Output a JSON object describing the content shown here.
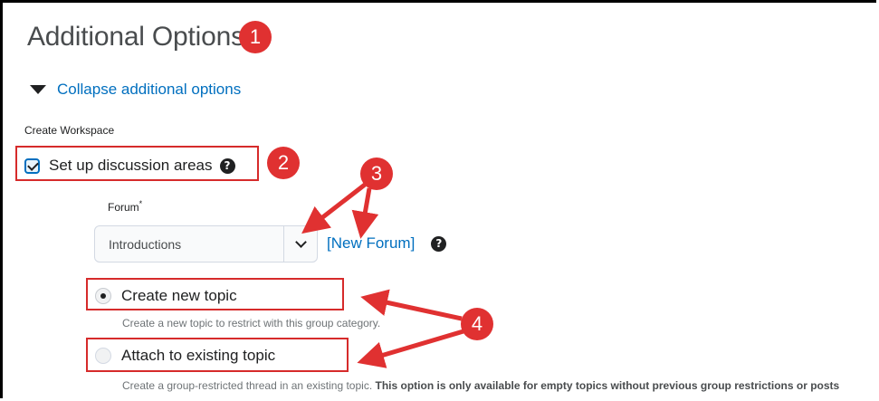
{
  "page": {
    "heading": "Additional Options",
    "collapse_link": "Collapse additional options",
    "section_label": "Create Workspace"
  },
  "discussion": {
    "checkbox_label": "Set up discussion areas",
    "checked": true,
    "help_glyph": "?"
  },
  "forum": {
    "label": "Forum",
    "required_mark": "*",
    "selected": "Introductions",
    "new_forum_link": "[New Forum]"
  },
  "topic": {
    "create_label": "Create new topic",
    "create_hint": "Create a new topic to restrict with this group category.",
    "attach_label": "Attach to existing topic",
    "attach_hint": "Create a group-restricted thread in an existing topic.",
    "attach_hint_bold": "This option is only available for empty topics without previous group restrictions or posts"
  },
  "annotations": {
    "badge1": "1",
    "badge2": "2",
    "badge3": "3",
    "badge4": "4",
    "accent_color": "#e03131"
  }
}
